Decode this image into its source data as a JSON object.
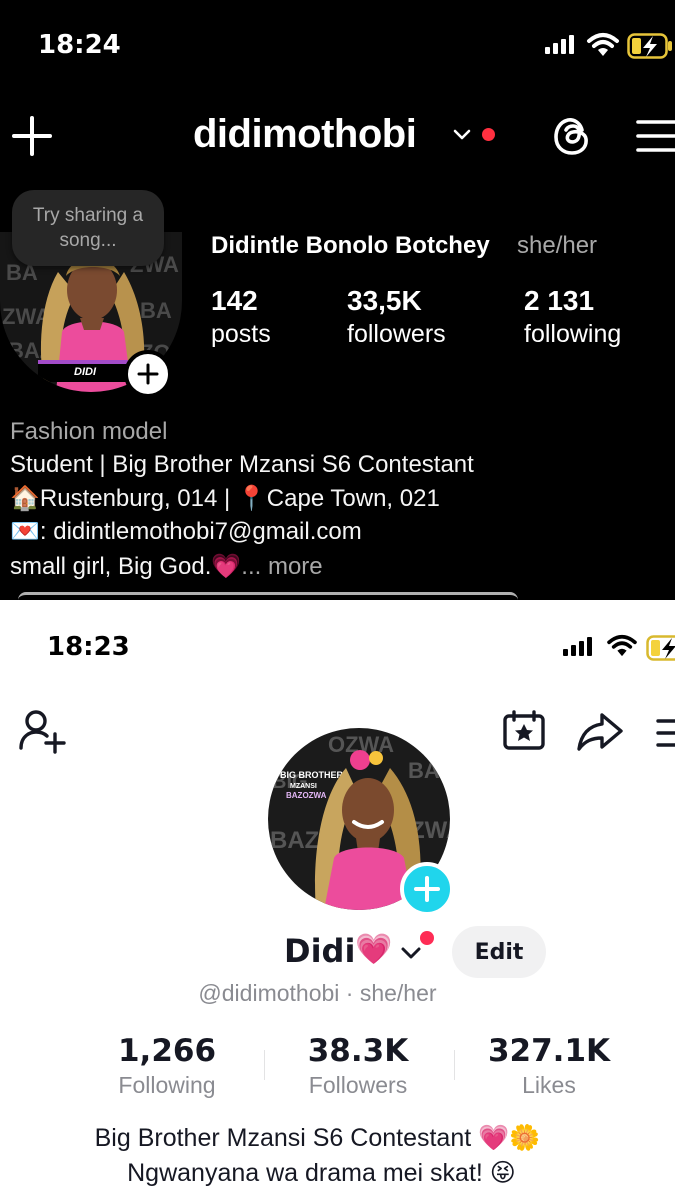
{
  "instagram": {
    "status_time": "18:24",
    "username": "didimothobi",
    "note_text": "Try sharing a song...",
    "avatar_label": "DIDI",
    "full_name": "Didintle Bonolo Botchey",
    "pronouns": "she/her",
    "stats": [
      {
        "value": "142",
        "label": "posts"
      },
      {
        "value": "33,5K",
        "label": "followers"
      },
      {
        "value": "2 131",
        "label": "following"
      }
    ],
    "category": "Fashion model",
    "bio": [
      "Student | Big Brother Mzansi S6 Contestant",
      "🏠Rustenburg, 014 | 📍Cape Town, 021",
      "💌: didintlemothobi7@gmail.com",
      "small girl, Big God.💗"
    ],
    "more_label": "... more",
    "icons": [
      "plus-icon",
      "chevron-down-icon",
      "threads-icon",
      "menu-icon",
      "wifi-icon",
      "battery-charging-icon"
    ],
    "colors": {
      "background": "#000000",
      "notification_dot": "#ff3040",
      "pill": "#262626",
      "muted_text": "#a8a8a8"
    }
  },
  "tiktok": {
    "status_time": "18:23",
    "display_name": "Didi",
    "name_emoji": "💗",
    "edit_label": "Edit",
    "handle": "@didimothobi · she/her",
    "avatar_text": [
      "BIG BROTHER",
      "MZANSI",
      "BAZOZWA"
    ],
    "stats": [
      {
        "value": "1,266",
        "label": "Following"
      },
      {
        "value": "38.3K",
        "label": "Followers"
      },
      {
        "value": "327.1K",
        "label": "Likes"
      }
    ],
    "bio": [
      "Big Brother Mzansi S6 Contestant 💗🌼",
      "Ngwanyana wa drama mei skat! 😝"
    ],
    "icons": [
      "add-user-icon",
      "calendar-star-icon",
      "share-icon",
      "menu-icon",
      "plus-icon",
      "chevron-down-icon"
    ],
    "colors": {
      "background": "#ffffff",
      "accent": "#20d5ec",
      "notification_dot": "#fe2c55",
      "edit_button": "#f1f1f2",
      "muted_text": "#8a8b91"
    }
  }
}
